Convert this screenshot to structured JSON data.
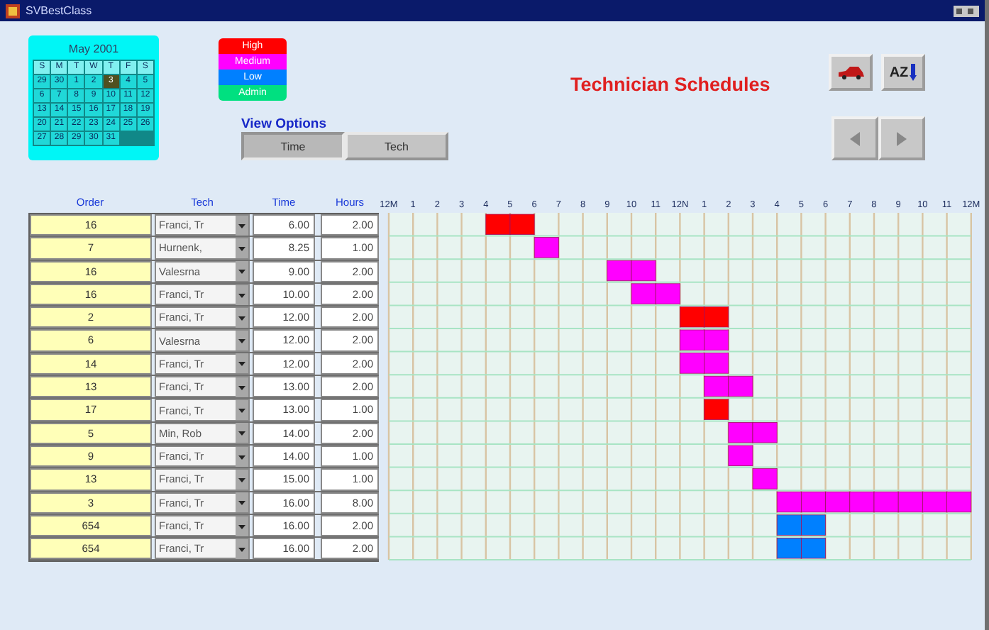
{
  "window": {
    "title": "SVBestClass"
  },
  "calendar": {
    "month": "May 2001",
    "weekdays": [
      "S",
      "M",
      "T",
      "W",
      "T",
      "F",
      "S"
    ],
    "weeks": [
      [
        {
          "day": "29",
          "selected": false
        },
        {
          "day": "30",
          "selected": false
        },
        {
          "day": "1",
          "selected": false
        },
        {
          "day": "2",
          "selected": false
        },
        {
          "day": "3",
          "selected": true
        },
        {
          "day": "4",
          "selected": false
        },
        {
          "day": "5",
          "selected": false
        }
      ],
      [
        {
          "day": "6",
          "selected": false
        },
        {
          "day": "7",
          "selected": false
        },
        {
          "day": "8",
          "selected": false
        },
        {
          "day": "9",
          "selected": false
        },
        {
          "day": "10",
          "selected": false
        },
        {
          "day": "11",
          "selected": false
        },
        {
          "day": "12",
          "selected": false
        }
      ],
      [
        {
          "day": "13",
          "selected": false
        },
        {
          "day": "14",
          "selected": false
        },
        {
          "day": "15",
          "selected": false
        },
        {
          "day": "16",
          "selected": false
        },
        {
          "day": "17",
          "selected": false
        },
        {
          "day": "18",
          "selected": false
        },
        {
          "day": "19",
          "selected": false
        }
      ],
      [
        {
          "day": "20",
          "selected": false
        },
        {
          "day": "21",
          "selected": false
        },
        {
          "day": "22",
          "selected": false
        },
        {
          "day": "23",
          "selected": false
        },
        {
          "day": "24",
          "selected": false
        },
        {
          "day": "25",
          "selected": false
        },
        {
          "day": "26",
          "selected": false
        }
      ],
      [
        {
          "day": "27",
          "selected": false
        },
        {
          "day": "28",
          "selected": false
        },
        {
          "day": "29",
          "selected": false
        },
        {
          "day": "30",
          "selected": false
        },
        {
          "day": "31",
          "selected": false
        }
      ]
    ]
  },
  "legend": [
    {
      "label": "High",
      "color": "#ff0000"
    },
    {
      "label": "Medium",
      "color": "#ff00ff"
    },
    {
      "label": "Low",
      "color": "#0080ff"
    },
    {
      "label": "Admin",
      "color": "#00e080"
    }
  ],
  "title": "Technician Schedules",
  "toolbar": {
    "sort_label": "AZ"
  },
  "view_options": {
    "label": "View Options",
    "buttons": [
      {
        "label": "Time",
        "selected": true
      },
      {
        "label": "Tech",
        "selected": false
      }
    ]
  },
  "table": {
    "columns": [
      "Order",
      "Tech",
      "Time",
      "Hours"
    ],
    "rows": [
      {
        "order": "16",
        "tech": "Franci, Tr",
        "time": "6.00",
        "hours": "2.00"
      },
      {
        "order": "7",
        "tech": "Hurnenk,",
        "time": "8.25",
        "hours": "1.00"
      },
      {
        "order": "16",
        "tech": "Valesrna",
        "time": "9.00",
        "hours": "2.00"
      },
      {
        "order": "16",
        "tech": "Franci, Tr",
        "time": "10.00",
        "hours": "2.00"
      },
      {
        "order": "2",
        "tech": "Franci, Tr",
        "time": "12.00",
        "hours": "2.00"
      },
      {
        "order": "6",
        "tech": "Valesrna",
        "time": "12.00",
        "hours": "2.00"
      },
      {
        "order": "14",
        "tech": "Franci, Tr",
        "time": "12.00",
        "hours": "2.00"
      },
      {
        "order": "13",
        "tech": "Franci, Tr",
        "time": "13.00",
        "hours": "2.00"
      },
      {
        "order": "17",
        "tech": "Franci, Tr",
        "time": "13.00",
        "hours": "1.00"
      },
      {
        "order": "5",
        "tech": "Min, Rob",
        "time": "14.00",
        "hours": "2.00"
      },
      {
        "order": "9",
        "tech": "Franci, Tr",
        "time": "14.00",
        "hours": "1.00"
      },
      {
        "order": "13",
        "tech": "Franci, Tr",
        "time": "15.00",
        "hours": "1.00"
      },
      {
        "order": "3",
        "tech": "Franci, Tr",
        "time": "16.00",
        "hours": "8.00"
      },
      {
        "order": "654",
        "tech": "Franci, Tr",
        "time": "16.00",
        "hours": "2.00"
      },
      {
        "order": "654",
        "tech": "Franci, Tr",
        "time": "16.00",
        "hours": "2.00"
      }
    ]
  },
  "schedule": {
    "hour_labels": [
      "12M",
      "1",
      "2",
      "3",
      "4",
      "5",
      "6",
      "7",
      "8",
      "9",
      "10",
      "11",
      "12N",
      "1",
      "2",
      "3",
      "4",
      "5",
      "6",
      "7",
      "8",
      "9",
      "10",
      "11",
      "12M"
    ],
    "rows": [
      {
        "slots": [
          {
            "kind": "free"
          },
          {
            "kind": "free"
          },
          {
            "kind": "free"
          },
          {
            "kind": "free"
          },
          {
            "kind": "high"
          },
          {
            "kind": "high"
          },
          {
            "kind": "free"
          },
          {
            "kind": "free"
          },
          {
            "kind": "free"
          },
          {
            "kind": "free"
          },
          {
            "kind": "free"
          },
          {
            "kind": "free"
          },
          {
            "kind": "free"
          },
          {
            "kind": "free"
          },
          {
            "kind": "free"
          },
          {
            "kind": "free"
          },
          {
            "kind": "free"
          },
          {
            "kind": "free"
          },
          {
            "kind": "free"
          },
          {
            "kind": "free"
          },
          {
            "kind": "free"
          },
          {
            "kind": "free"
          },
          {
            "kind": "free"
          },
          {
            "kind": "free"
          }
        ]
      },
      {
        "slots": [
          {
            "kind": "free"
          },
          {
            "kind": "free"
          },
          {
            "kind": "free"
          },
          {
            "kind": "free"
          },
          {
            "kind": "free"
          },
          {
            "kind": "free"
          },
          {
            "kind": "medium"
          },
          {
            "kind": "free"
          },
          {
            "kind": "free"
          },
          {
            "kind": "free"
          },
          {
            "kind": "free"
          },
          {
            "kind": "free"
          },
          {
            "kind": "free"
          },
          {
            "kind": "free"
          },
          {
            "kind": "free"
          },
          {
            "kind": "free"
          },
          {
            "kind": "free"
          },
          {
            "kind": "free"
          },
          {
            "kind": "free"
          },
          {
            "kind": "free"
          },
          {
            "kind": "free"
          },
          {
            "kind": "free"
          },
          {
            "kind": "free"
          },
          {
            "kind": "free"
          }
        ]
      },
      {
        "slots": [
          {
            "kind": "free"
          },
          {
            "kind": "free"
          },
          {
            "kind": "free"
          },
          {
            "kind": "free"
          },
          {
            "kind": "free"
          },
          {
            "kind": "free"
          },
          {
            "kind": "free"
          },
          {
            "kind": "free"
          },
          {
            "kind": "free"
          },
          {
            "kind": "medium"
          },
          {
            "kind": "medium"
          },
          {
            "kind": "free"
          },
          {
            "kind": "free"
          },
          {
            "kind": "free"
          },
          {
            "kind": "free"
          },
          {
            "kind": "free"
          },
          {
            "kind": "free"
          },
          {
            "kind": "free"
          },
          {
            "kind": "free"
          },
          {
            "kind": "free"
          },
          {
            "kind": "free"
          },
          {
            "kind": "free"
          },
          {
            "kind": "free"
          },
          {
            "kind": "free"
          }
        ]
      },
      {
        "slots": [
          {
            "kind": "free"
          },
          {
            "kind": "free"
          },
          {
            "kind": "free"
          },
          {
            "kind": "free"
          },
          {
            "kind": "free"
          },
          {
            "kind": "free"
          },
          {
            "kind": "free"
          },
          {
            "kind": "free"
          },
          {
            "kind": "free"
          },
          {
            "kind": "free"
          },
          {
            "kind": "medium"
          },
          {
            "kind": "medium"
          },
          {
            "kind": "free"
          },
          {
            "kind": "free"
          },
          {
            "kind": "free"
          },
          {
            "kind": "free"
          },
          {
            "kind": "free"
          },
          {
            "kind": "free"
          },
          {
            "kind": "free"
          },
          {
            "kind": "free"
          },
          {
            "kind": "free"
          },
          {
            "kind": "free"
          },
          {
            "kind": "free"
          },
          {
            "kind": "free"
          }
        ]
      },
      {
        "slots": [
          {
            "kind": "free"
          },
          {
            "kind": "free"
          },
          {
            "kind": "free"
          },
          {
            "kind": "free"
          },
          {
            "kind": "free"
          },
          {
            "kind": "free"
          },
          {
            "kind": "free"
          },
          {
            "kind": "free"
          },
          {
            "kind": "free"
          },
          {
            "kind": "free"
          },
          {
            "kind": "free"
          },
          {
            "kind": "free"
          },
          {
            "kind": "high"
          },
          {
            "kind": "high"
          },
          {
            "kind": "free"
          },
          {
            "kind": "free"
          },
          {
            "kind": "free"
          },
          {
            "kind": "free"
          },
          {
            "kind": "free"
          },
          {
            "kind": "free"
          },
          {
            "kind": "free"
          },
          {
            "kind": "free"
          },
          {
            "kind": "free"
          },
          {
            "kind": "free"
          }
        ]
      },
      {
        "slots": [
          {
            "kind": "free"
          },
          {
            "kind": "free"
          },
          {
            "kind": "free"
          },
          {
            "kind": "free"
          },
          {
            "kind": "free"
          },
          {
            "kind": "free"
          },
          {
            "kind": "free"
          },
          {
            "kind": "free"
          },
          {
            "kind": "free"
          },
          {
            "kind": "free"
          },
          {
            "kind": "free"
          },
          {
            "kind": "free"
          },
          {
            "kind": "medium"
          },
          {
            "kind": "medium"
          },
          {
            "kind": "free"
          },
          {
            "kind": "free"
          },
          {
            "kind": "free"
          },
          {
            "kind": "free"
          },
          {
            "kind": "free"
          },
          {
            "kind": "free"
          },
          {
            "kind": "free"
          },
          {
            "kind": "free"
          },
          {
            "kind": "free"
          },
          {
            "kind": "free"
          }
        ]
      },
      {
        "slots": [
          {
            "kind": "free"
          },
          {
            "kind": "free"
          },
          {
            "kind": "free"
          },
          {
            "kind": "free"
          },
          {
            "kind": "free"
          },
          {
            "kind": "free"
          },
          {
            "kind": "free"
          },
          {
            "kind": "free"
          },
          {
            "kind": "free"
          },
          {
            "kind": "free"
          },
          {
            "kind": "free"
          },
          {
            "kind": "free"
          },
          {
            "kind": "medium"
          },
          {
            "kind": "medium"
          },
          {
            "kind": "free"
          },
          {
            "kind": "free"
          },
          {
            "kind": "free"
          },
          {
            "kind": "free"
          },
          {
            "kind": "free"
          },
          {
            "kind": "free"
          },
          {
            "kind": "free"
          },
          {
            "kind": "free"
          },
          {
            "kind": "free"
          },
          {
            "kind": "free"
          }
        ]
      },
      {
        "slots": [
          {
            "kind": "free"
          },
          {
            "kind": "free"
          },
          {
            "kind": "free"
          },
          {
            "kind": "free"
          },
          {
            "kind": "free"
          },
          {
            "kind": "free"
          },
          {
            "kind": "free"
          },
          {
            "kind": "free"
          },
          {
            "kind": "free"
          },
          {
            "kind": "free"
          },
          {
            "kind": "free"
          },
          {
            "kind": "free"
          },
          {
            "kind": "free"
          },
          {
            "kind": "medium"
          },
          {
            "kind": "medium"
          },
          {
            "kind": "free"
          },
          {
            "kind": "free"
          },
          {
            "kind": "free"
          },
          {
            "kind": "free"
          },
          {
            "kind": "free"
          },
          {
            "kind": "free"
          },
          {
            "kind": "free"
          },
          {
            "kind": "free"
          },
          {
            "kind": "free"
          }
        ]
      },
      {
        "slots": [
          {
            "kind": "free"
          },
          {
            "kind": "free"
          },
          {
            "kind": "free"
          },
          {
            "kind": "free"
          },
          {
            "kind": "free"
          },
          {
            "kind": "free"
          },
          {
            "kind": "free"
          },
          {
            "kind": "free"
          },
          {
            "kind": "free"
          },
          {
            "kind": "free"
          },
          {
            "kind": "free"
          },
          {
            "kind": "free"
          },
          {
            "kind": "free"
          },
          {
            "kind": "high"
          },
          {
            "kind": "free"
          },
          {
            "kind": "free"
          },
          {
            "kind": "free"
          },
          {
            "kind": "free"
          },
          {
            "kind": "free"
          },
          {
            "kind": "free"
          },
          {
            "kind": "free"
          },
          {
            "kind": "free"
          },
          {
            "kind": "free"
          },
          {
            "kind": "free"
          }
        ]
      },
      {
        "slots": [
          {
            "kind": "free"
          },
          {
            "kind": "free"
          },
          {
            "kind": "free"
          },
          {
            "kind": "free"
          },
          {
            "kind": "free"
          },
          {
            "kind": "free"
          },
          {
            "kind": "free"
          },
          {
            "kind": "free"
          },
          {
            "kind": "free"
          },
          {
            "kind": "free"
          },
          {
            "kind": "free"
          },
          {
            "kind": "free"
          },
          {
            "kind": "free"
          },
          {
            "kind": "free"
          },
          {
            "kind": "medium"
          },
          {
            "kind": "medium"
          },
          {
            "kind": "free"
          },
          {
            "kind": "free"
          },
          {
            "kind": "free"
          },
          {
            "kind": "free"
          },
          {
            "kind": "free"
          },
          {
            "kind": "free"
          },
          {
            "kind": "free"
          },
          {
            "kind": "free"
          }
        ]
      },
      {
        "slots": [
          {
            "kind": "free"
          },
          {
            "kind": "free"
          },
          {
            "kind": "free"
          },
          {
            "kind": "free"
          },
          {
            "kind": "free"
          },
          {
            "kind": "free"
          },
          {
            "kind": "free"
          },
          {
            "kind": "free"
          },
          {
            "kind": "free"
          },
          {
            "kind": "free"
          },
          {
            "kind": "free"
          },
          {
            "kind": "free"
          },
          {
            "kind": "free"
          },
          {
            "kind": "free"
          },
          {
            "kind": "medium"
          },
          {
            "kind": "free"
          },
          {
            "kind": "free"
          },
          {
            "kind": "free"
          },
          {
            "kind": "free"
          },
          {
            "kind": "free"
          },
          {
            "kind": "free"
          },
          {
            "kind": "free"
          },
          {
            "kind": "free"
          },
          {
            "kind": "free"
          }
        ]
      },
      {
        "slots": [
          {
            "kind": "free"
          },
          {
            "kind": "free"
          },
          {
            "kind": "free"
          },
          {
            "kind": "free"
          },
          {
            "kind": "free"
          },
          {
            "kind": "free"
          },
          {
            "kind": "free"
          },
          {
            "kind": "free"
          },
          {
            "kind": "free"
          },
          {
            "kind": "free"
          },
          {
            "kind": "free"
          },
          {
            "kind": "free"
          },
          {
            "kind": "free"
          },
          {
            "kind": "free"
          },
          {
            "kind": "free"
          },
          {
            "kind": "medium"
          },
          {
            "kind": "free"
          },
          {
            "kind": "free"
          },
          {
            "kind": "free"
          },
          {
            "kind": "free"
          },
          {
            "kind": "free"
          },
          {
            "kind": "free"
          },
          {
            "kind": "free"
          },
          {
            "kind": "free"
          }
        ]
      },
      {
        "slots": [
          {
            "kind": "free"
          },
          {
            "kind": "free"
          },
          {
            "kind": "free"
          },
          {
            "kind": "free"
          },
          {
            "kind": "free"
          },
          {
            "kind": "free"
          },
          {
            "kind": "free"
          },
          {
            "kind": "free"
          },
          {
            "kind": "free"
          },
          {
            "kind": "free"
          },
          {
            "kind": "free"
          },
          {
            "kind": "free"
          },
          {
            "kind": "free"
          },
          {
            "kind": "free"
          },
          {
            "kind": "free"
          },
          {
            "kind": "free"
          },
          {
            "kind": "medium"
          },
          {
            "kind": "medium"
          },
          {
            "kind": "medium"
          },
          {
            "kind": "medium"
          },
          {
            "kind": "medium"
          },
          {
            "kind": "medium"
          },
          {
            "kind": "medium"
          },
          {
            "kind": "medium"
          }
        ]
      },
      {
        "slots": [
          {
            "kind": "free"
          },
          {
            "kind": "free"
          },
          {
            "kind": "free"
          },
          {
            "kind": "free"
          },
          {
            "kind": "free"
          },
          {
            "kind": "free"
          },
          {
            "kind": "free"
          },
          {
            "kind": "free"
          },
          {
            "kind": "free"
          },
          {
            "kind": "free"
          },
          {
            "kind": "free"
          },
          {
            "kind": "free"
          },
          {
            "kind": "free"
          },
          {
            "kind": "free"
          },
          {
            "kind": "free"
          },
          {
            "kind": "free"
          },
          {
            "kind": "low"
          },
          {
            "kind": "low"
          },
          {
            "kind": "free"
          },
          {
            "kind": "free"
          },
          {
            "kind": "free"
          },
          {
            "kind": "free"
          },
          {
            "kind": "free"
          },
          {
            "kind": "free"
          }
        ]
      },
      {
        "slots": [
          {
            "kind": "free"
          },
          {
            "kind": "free"
          },
          {
            "kind": "free"
          },
          {
            "kind": "free"
          },
          {
            "kind": "free"
          },
          {
            "kind": "free"
          },
          {
            "kind": "free"
          },
          {
            "kind": "free"
          },
          {
            "kind": "free"
          },
          {
            "kind": "free"
          },
          {
            "kind": "free"
          },
          {
            "kind": "free"
          },
          {
            "kind": "free"
          },
          {
            "kind": "free"
          },
          {
            "kind": "free"
          },
          {
            "kind": "free"
          },
          {
            "kind": "low"
          },
          {
            "kind": "low"
          },
          {
            "kind": "free"
          },
          {
            "kind": "free"
          },
          {
            "kind": "free"
          },
          {
            "kind": "free"
          },
          {
            "kind": "free"
          },
          {
            "kind": "free"
          }
        ]
      }
    ]
  }
}
